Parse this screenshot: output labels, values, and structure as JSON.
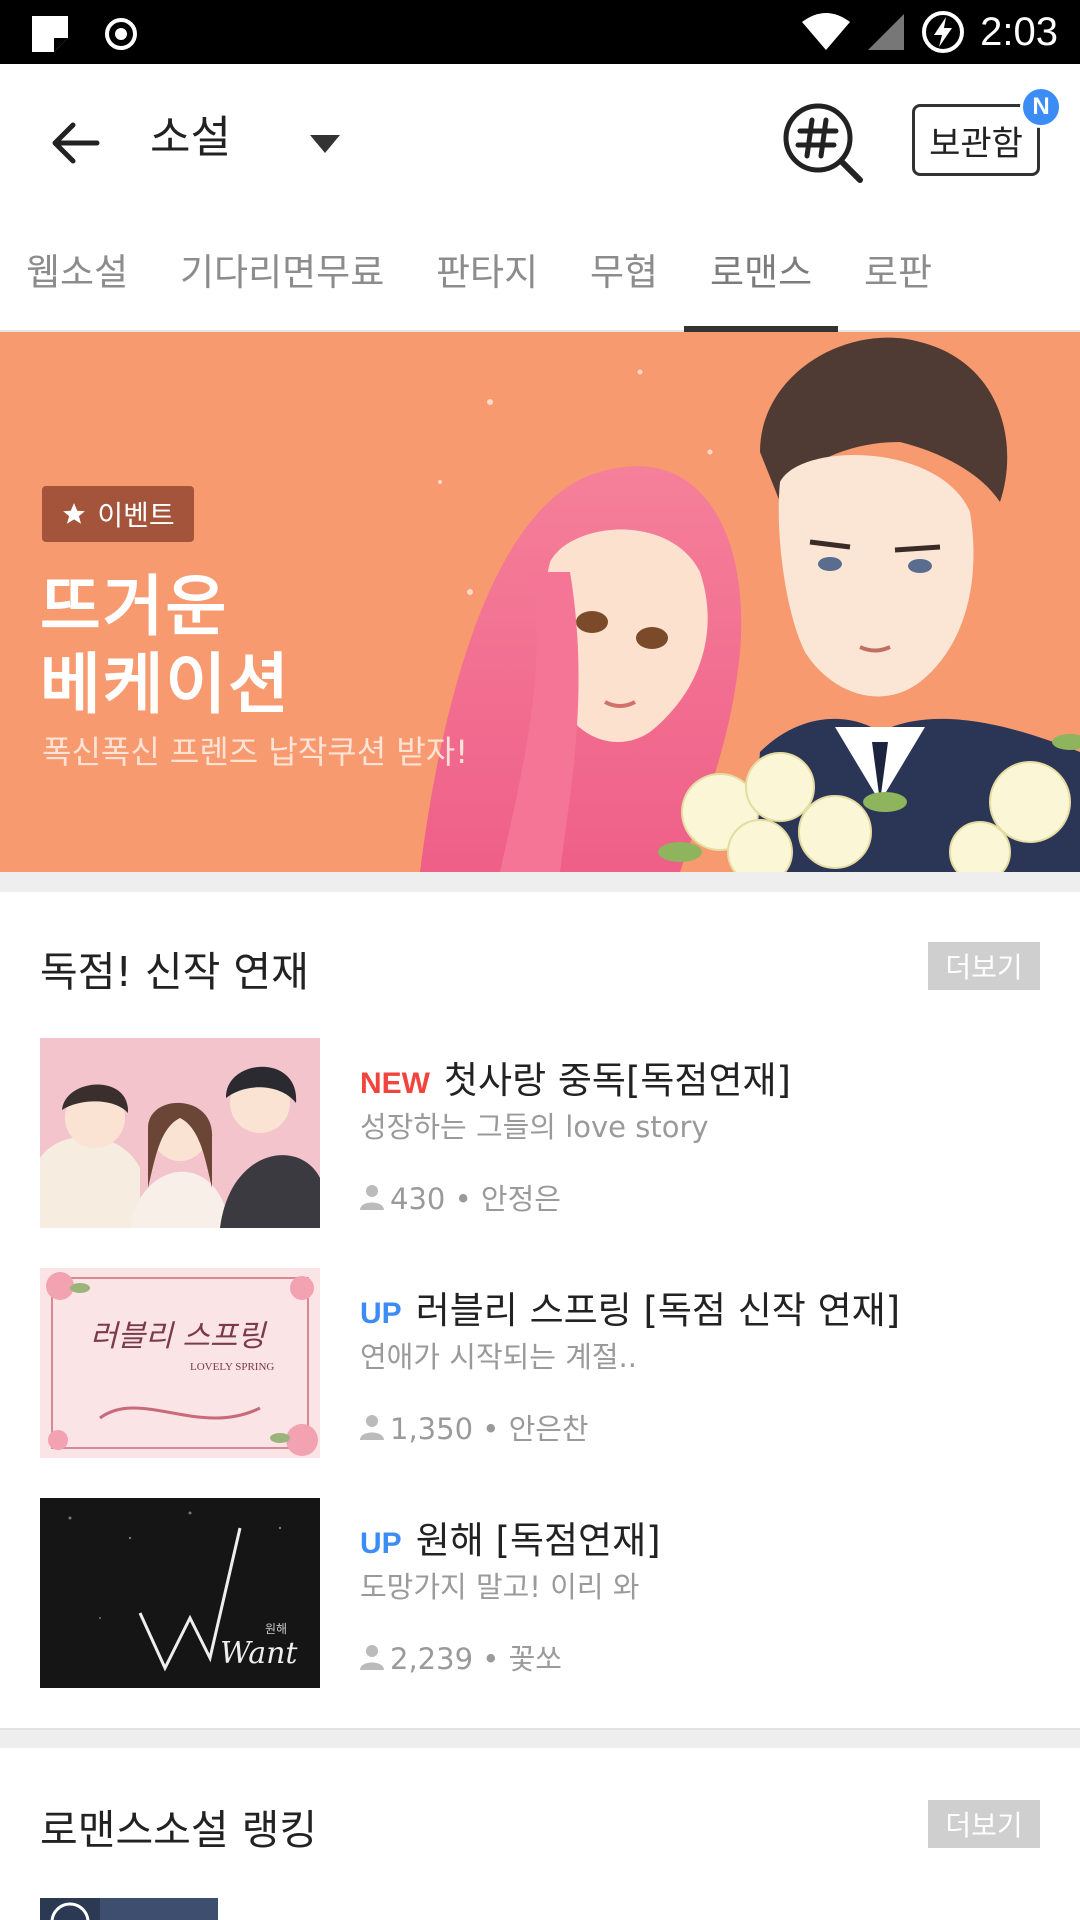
{
  "status_bar": {
    "time": "2:03",
    "icons": [
      "note-icon",
      "record-icon",
      "wifi-icon",
      "signal-icon",
      "battery-charging-icon"
    ]
  },
  "app_bar": {
    "title": "소설",
    "storage_label": "보관함",
    "new_badge": "N"
  },
  "tabs": [
    {
      "label": "웹소설"
    },
    {
      "label": "기다리면무료"
    },
    {
      "label": "판타지"
    },
    {
      "label": "무협"
    },
    {
      "label": "로맨스",
      "active": true
    },
    {
      "label": "로판"
    }
  ],
  "banner": {
    "badge": "이벤트",
    "title_line1": "뜨거운",
    "title_line2": "베케이션",
    "subtitle": "폭신폭신 프렌즈 납작쿠션 받자!"
  },
  "section1": {
    "title": "독점! 신작 연재",
    "more": "더보기",
    "items": [
      {
        "badge": "NEW",
        "title": "첫사랑 중독[독점연재]",
        "desc": "성장하는 그들의 love story",
        "meta": "430 • 안정은"
      },
      {
        "badge": "UP",
        "title": "러블리 스프링 [독점 신작 연재]",
        "desc": "연애가 시작되는 계절..",
        "meta": "1,350 • 안은찬",
        "thumb_text": "러블리 스프링",
        "thumb_sub": "LOVELY SPRING"
      },
      {
        "badge": "UP",
        "title": "원해 [독점연재]",
        "desc": "도망가지 말고! 이리 와",
        "meta": "2,239 • 꽃쏘",
        "thumb_text": "Want",
        "thumb_sub": "원해"
      }
    ]
  },
  "section2": {
    "title": "로맨스소설 랭킹",
    "more": "더보기"
  },
  "colors": {
    "banner_bg": "#f79a6f",
    "badge_new": "#f2443d",
    "badge_up": "#3b8cf5",
    "accent_dot": "#3b8cf5"
  }
}
